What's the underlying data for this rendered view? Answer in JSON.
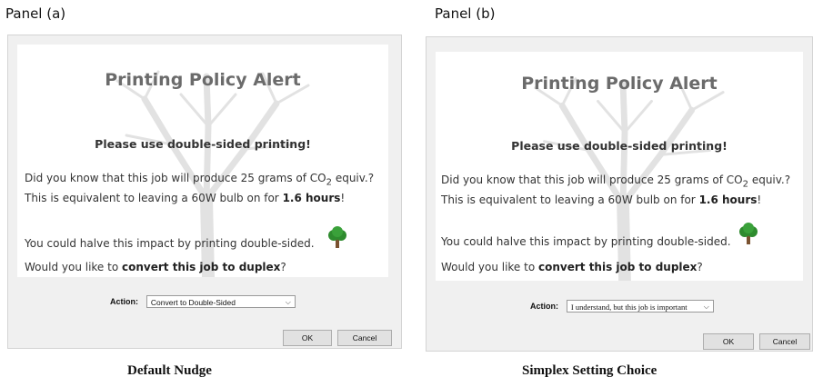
{
  "panel_a": {
    "label": "Panel (a)",
    "title": "Printing Policy Alert",
    "subtitle": "Please use double-sided printing!",
    "line1_pre": "Did you know that this job will produce 25 grams of CO",
    "line1_sub": "2",
    "line1_post": " equiv.?",
    "line2_pre": "This is equivalent to leaving a 60W bulb on for ",
    "line2_bold": "1.6 hours",
    "line2_post": "!",
    "line3": "You could halve this impact by printing double-sided.",
    "line4_pre": "Would you like to ",
    "line4_bold": "convert this job to duplex",
    "line4_post": "?",
    "action_label": "Action:",
    "action_value": "Convert to Double-Sided",
    "ok": "OK",
    "cancel": "Cancel",
    "caption": "Default Nudge"
  },
  "panel_b": {
    "label": "Panel (b)",
    "title": "Printing Policy Alert",
    "subtitle": "Please use double-sided printing!",
    "line1_pre": "Did you know that this job will produce 25 grams of CO",
    "line1_sub": "2",
    "line1_post": " equiv.?",
    "line2_pre": "This is equivalent to leaving a 60W bulb on for ",
    "line2_bold": "1.6 hours",
    "line2_post": "!",
    "line3": "You could halve this impact by printing double-sided.",
    "line4_pre": "Would you like to ",
    "line4_bold": "convert this job to duplex",
    "line4_post": "?",
    "action_label": "Action:",
    "action_value": "I understand, but this job is important",
    "ok": "OK",
    "cancel": "Cancel",
    "caption": "Simplex Setting Choice"
  },
  "colors": {
    "dialog_bg": "#f0f0f0",
    "title_gray": "#6b6b6b",
    "tree_green": "#2e8b2e"
  },
  "icons": [
    "tree-icon",
    "chevron-down-icon",
    "tree-watermark"
  ]
}
